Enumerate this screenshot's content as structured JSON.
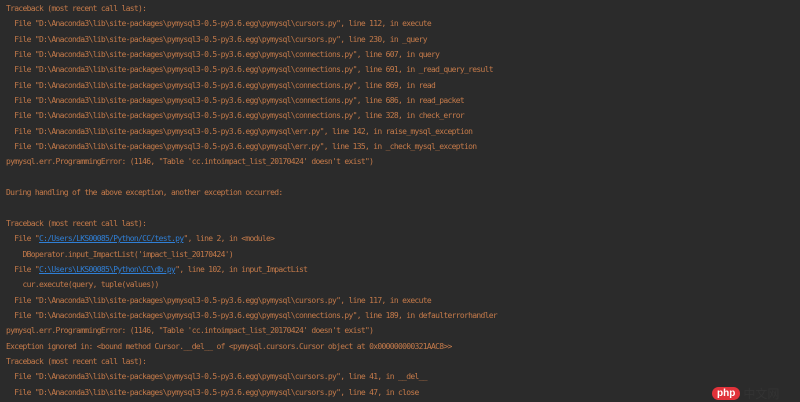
{
  "colors": {
    "background": "#2b2b2b",
    "error_text": "#c47a4a",
    "link": "#2f7fd6"
  },
  "lines": [
    {
      "text": "Traceback (most recent call last):"
    },
    {
      "text": "  File \"D:\\Anaconda3\\lib\\site-packages\\pymysql3-0.5-py3.6.egg\\pymysql\\cursors.py\", line 112, in execute"
    },
    {
      "text": "  File \"D:\\Anaconda3\\lib\\site-packages\\pymysql3-0.5-py3.6.egg\\pymysql\\cursors.py\", line 230, in _query"
    },
    {
      "text": "  File \"D:\\Anaconda3\\lib\\site-packages\\pymysql3-0.5-py3.6.egg\\pymysql\\connections.py\", line 607, in query"
    },
    {
      "text": "  File \"D:\\Anaconda3\\lib\\site-packages\\pymysql3-0.5-py3.6.egg\\pymysql\\connections.py\", line 691, in _read_query_result"
    },
    {
      "text": "  File \"D:\\Anaconda3\\lib\\site-packages\\pymysql3-0.5-py3.6.egg\\pymysql\\connections.py\", line 869, in read"
    },
    {
      "text": "  File \"D:\\Anaconda3\\lib\\site-packages\\pymysql3-0.5-py3.6.egg\\pymysql\\connections.py\", line 686, in read_packet"
    },
    {
      "text": "  File \"D:\\Anaconda3\\lib\\site-packages\\pymysql3-0.5-py3.6.egg\\pymysql\\connections.py\", line 328, in check_error"
    },
    {
      "text": "  File \"D:\\Anaconda3\\lib\\site-packages\\pymysql3-0.5-py3.6.egg\\pymysql\\err.py\", line 142, in raise_mysql_exception"
    },
    {
      "text": "  File \"D:\\Anaconda3\\lib\\site-packages\\pymysql3-0.5-py3.6.egg\\pymysql\\err.py\", line 135, in _check_mysql_exception"
    },
    {
      "text": "pymysql.err.ProgrammingError: (1146, \"Table 'cc.intoimpact_list_20170424' doesn't exist\")"
    },
    {
      "text": ""
    },
    {
      "text": "During handling of the above exception, another exception occurred:"
    },
    {
      "text": ""
    },
    {
      "text": "Traceback (most recent call last):"
    },
    {
      "pre": "  File \"",
      "link": "C:/Users/LKS00085/Python/CC/test.py",
      "post": "\", line 2, in <module>"
    },
    {
      "text": "    DBoperator.input_ImpactList('impact_list_20170424')"
    },
    {
      "pre": "  File \"",
      "link": "C:\\Users\\LKS00085\\Python\\CC\\db.py",
      "post": "\", line 102, in input_ImpactList"
    },
    {
      "text": "    cur.execute(query, tuple(values))"
    },
    {
      "text": "  File \"D:\\Anaconda3\\lib\\site-packages\\pymysql3-0.5-py3.6.egg\\pymysql\\cursors.py\", line 117, in execute"
    },
    {
      "text": "  File \"D:\\Anaconda3\\lib\\site-packages\\pymysql3-0.5-py3.6.egg\\pymysql\\connections.py\", line 189, in defaulterrorhandler"
    },
    {
      "text": "pymysql.err.ProgrammingError: (1146, \"Table 'cc.intoimpact_list_20170424' doesn't exist\")"
    },
    {
      "text": "Exception ignored in: <bound method Cursor.__del__ of <pymysql.cursors.Cursor object at 0x000000000321AAC8>>"
    },
    {
      "text": "Traceback (most recent call last):"
    },
    {
      "text": "  File \"D:\\Anaconda3\\lib\\site-packages\\pymysql3-0.5-py3.6.egg\\pymysql\\cursors.py\", line 41, in __del__"
    },
    {
      "text": "  File \"D:\\Anaconda3\\lib\\site-packages\\pymysql3-0.5-py3.6.egg\\pymysql\\cursors.py\", line 47, in close"
    }
  ],
  "watermark": {
    "badge": "php",
    "text": "中文网"
  }
}
